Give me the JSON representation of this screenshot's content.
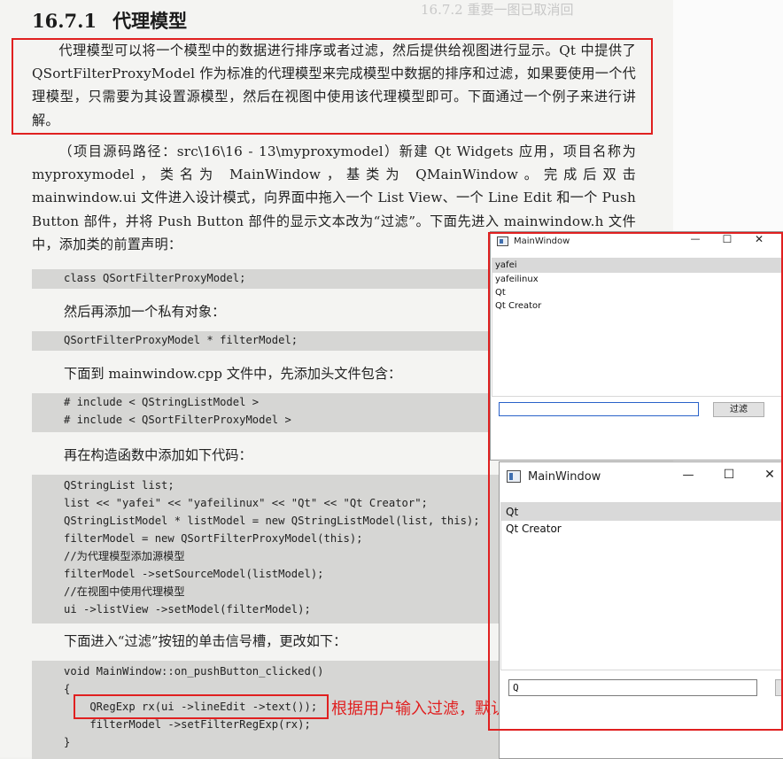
{
  "bleed_text": "16.7.2 重要一图已取消回",
  "section": {
    "number": "16.7.1",
    "title": "代理模型"
  },
  "intro_paragraph": "代理模型可以将一个模型中的数据进行排序或者过滤，然后提供给视图进行显示。Qt 中提供了 QSortFilterProxyModel 作为标准的代理模型来完成模型中数据的排序和过滤，如果要使用一个代理模型，只需要为其设置源模型，然后在视图中使用该代理模型即可。下面通过一个例子来进行讲解。",
  "project_paragraph": "（项目源码路径：src\\16\\16 - 13\\myproxymodel）新建 Qt Widgets 应用，项目名称为 myproxymodel，类名为 MainWindow，基类为 QMainWindow。完成后双击 mainwindow.ui 文件进入设计模式，向界面中拖入一个 List View、一个 Line Edit 和一个 Push Button 部件，并将 Push Button 部件的显示文本改为“过滤”。下面先进入 mainwindow.h 文件中，添加类的前置声明：",
  "code_forward_decl": [
    "class QSortFilterProxyModel;"
  ],
  "text_private": "然后再添加一个私有对象：",
  "code_private": [
    "QSortFilterProxyModel * filterModel;"
  ],
  "text_cpp": "下面到 mainwindow.cpp 文件中，先添加头文件包含：",
  "code_includes": [
    "# include < QStringListModel >",
    "# include < QSortFilterProxyModel >"
  ],
  "text_ctor": "再在构造函数中添加如下代码：",
  "code_ctor": [
    "QStringList list;",
    "list << \"yafei\" << \"yafeilinux\" << \"Qt\" << \"Qt Creator\";",
    "QStringListModel * listModel = new QStringListModel(list, this);",
    "filterModel = new QSortFilterProxyModel(this);",
    "//为代理模型添加源模型",
    "filterModel ->setSourceModel(listModel);",
    "//在视图中使用代理模型",
    "ui ->listView ->setModel(filterModel);"
  ],
  "text_slot": "下面进入“过滤”按钮的单击信号槽，更改如下：",
  "code_slot": [
    "void MainWindow::on_pushButton_clicked()",
    "{",
    "    QRegExp rx(ui ->lineEdit ->text());",
    "    filterModel ->setFilterRegExp(rx);",
    "}"
  ],
  "annotation": "根据用户输入过滤，默认区分大小写",
  "window1": {
    "title": "MainWindow",
    "controls": {
      "minimize": "—",
      "maximize": "☐",
      "close": "✕"
    },
    "items": [
      "yafei",
      "yafeilinux",
      "Qt",
      "Qt Creator"
    ],
    "selected_index": 0,
    "lineedit_value": "",
    "button_label": "过滤"
  },
  "window2": {
    "title": "MainWindow",
    "controls": {
      "minimize": "—",
      "maximize": "☐",
      "close": "✕"
    },
    "items": [
      "Qt",
      "Qt Creator"
    ],
    "selected_index": 0,
    "lineedit_value": "Q"
  },
  "colors": {
    "highlight": "#e02020",
    "code_bg": "#d6d6d4",
    "page": "#f4f4f2"
  }
}
